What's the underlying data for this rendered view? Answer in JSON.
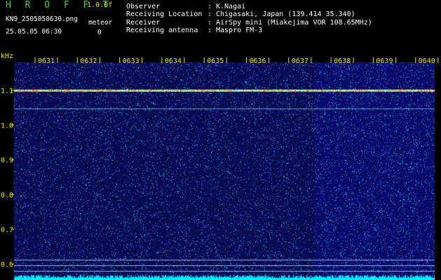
{
  "header": {
    "logo": "H R O F F T",
    "version": "1.0.0f",
    "filename": "KN9_2505050630.png",
    "datetime": "25.05.05 06:30",
    "detect_label": "meteor",
    "detect_count": "0",
    "observer_label": "Observer",
    "observer_value": "K.Nagai",
    "location_label": "Receiving Location",
    "location_value": "Chigasaki, Japan (139.414 35.340)",
    "receiver_label": "Receiver",
    "receiver_value": "AirSpy mini (Miakejima VOR 108.65MHz)",
    "antenna_label": "Receiving antenna",
    "antenna_value": "Maspro FM-3",
    "separator": ":"
  },
  "axis": {
    "y_unit": "kHz",
    "x_ticks": [
      "0631",
      "0632",
      "0633",
      "0634",
      "0635",
      "0636",
      "0637",
      "0638",
      "0639",
      "0640"
    ],
    "y_ticks": [
      "1.1",
      "1.0",
      "0.9",
      "0.8",
      "0.7",
      "0.6"
    ]
  },
  "colors": {
    "background": "#000000",
    "logo": "#3ad23a",
    "axis_text": "#e8e800",
    "spectrogram_base": "#0a0a5a",
    "noise_floor": "#00ffff"
  }
}
